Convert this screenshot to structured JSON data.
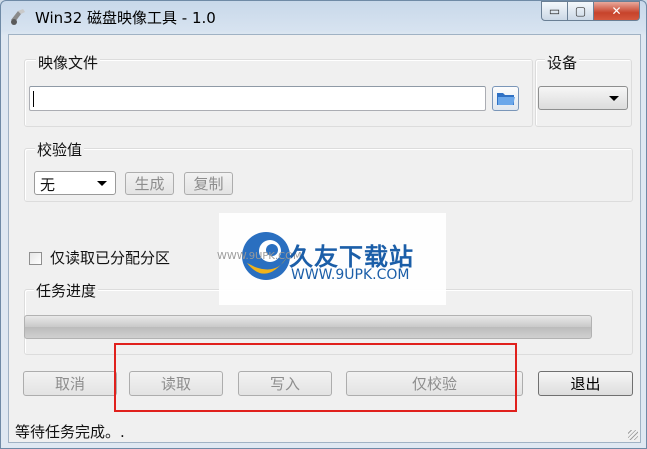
{
  "window": {
    "title": "Win32 磁盘映像工具 - 1.0",
    "min_icon": "minimize-icon",
    "max_icon": "maximize-icon",
    "close_icon": "close-icon",
    "min_glyph": "▭",
    "max_glyph": "▢",
    "close_glyph": "✕"
  },
  "image_file": {
    "label": "映像文件",
    "value": "",
    "browse_icon": "folder-icon"
  },
  "device": {
    "label": "设备",
    "selected": ""
  },
  "checksum": {
    "label": "校验值",
    "selected": "无",
    "generate_label": "生成",
    "copy_label": "复制"
  },
  "read_only_alloc": {
    "label": "仅读取已分配分区",
    "checked": false
  },
  "progress": {
    "label": "任务进度",
    "value": 0
  },
  "actions": {
    "cancel": "取消",
    "read": "读取",
    "write": "写入",
    "verify_only": "仅校验",
    "exit": "退出"
  },
  "status": {
    "text": "等待任务完成。."
  },
  "watermark": {
    "name": "久友下载站",
    "url": "WWW.9UPK.COM",
    "small": "WWW.9UPK.COM"
  },
  "colors": {
    "highlight_box": "#e0201c",
    "watermark_blue": "#1b5ea8"
  }
}
